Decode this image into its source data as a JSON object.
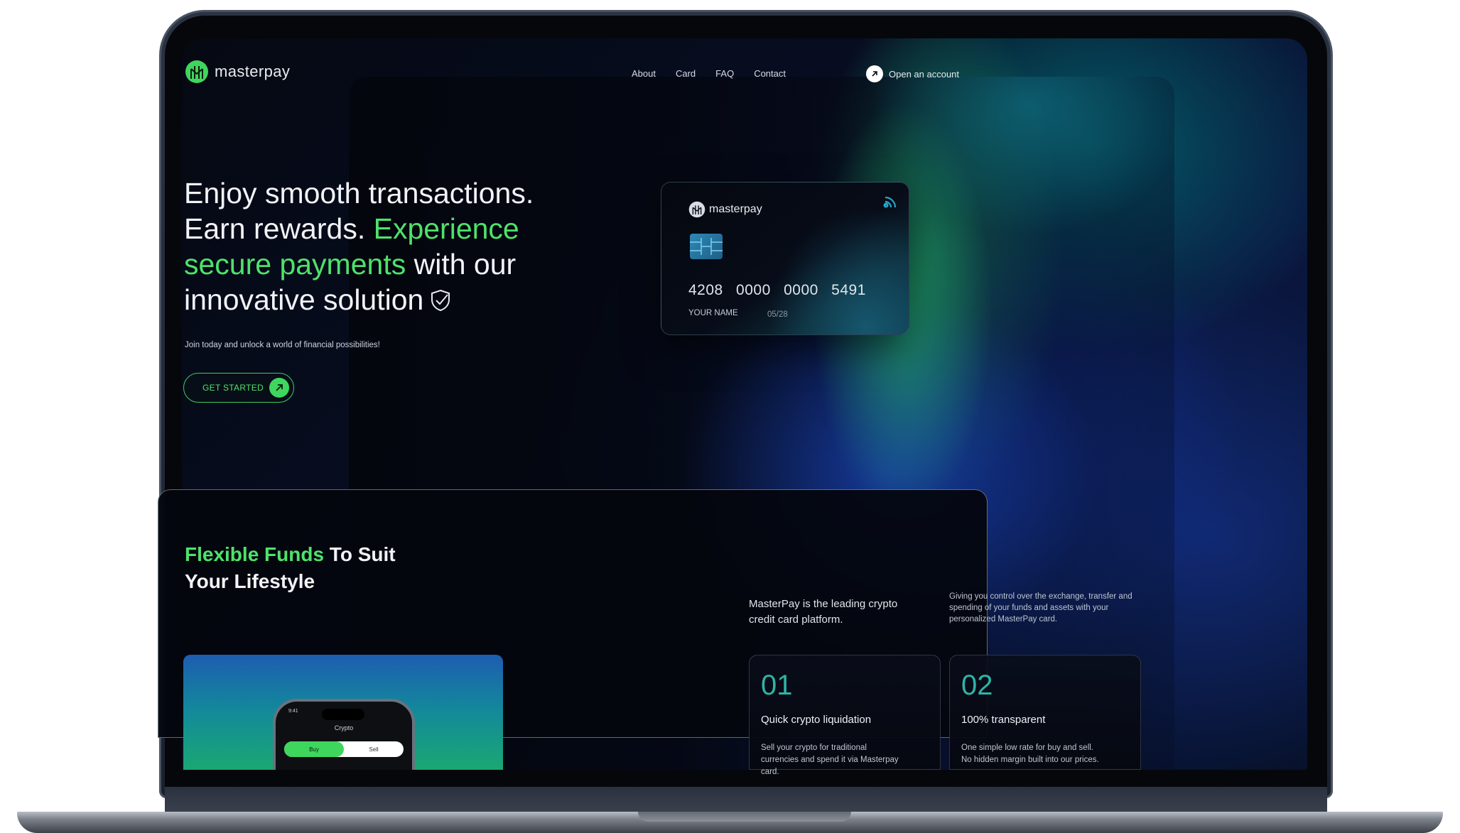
{
  "brand": {
    "name": "masterpay",
    "accent_color": "#4ee26a"
  },
  "nav": {
    "links": [
      "About",
      "Card",
      "FAQ",
      "Contact"
    ],
    "cta_label": "Open an account"
  },
  "hero": {
    "title_part1": "Enjoy smooth transactions. Earn rewards. ",
    "title_accent": "Experience secure payments",
    "title_part2": " with our innovative solution",
    "subtitle": "Join today and unlock a world of financial possibilities!",
    "cta_label": "GET STARTED"
  },
  "card": {
    "brand": "masterpay",
    "number": "4208 0000 0000 5491",
    "holder": "YOUR NAME",
    "expiry": "05/28"
  },
  "features": {
    "title_accent": "Flexible Funds",
    "title_rest": " To Suit Your Lifestyle",
    "lead": "MasterPay is the leading crypto credit card platform.",
    "description": "Giving you control over the exchange, transfer and spending of your funds and assets with your personalized MasterPay card.",
    "phone": {
      "time": "9:41",
      "title": "Crypto",
      "buy_label": "Buy",
      "sell_label": "Sell"
    },
    "items": [
      {
        "number": "01",
        "heading": "Quick crypto liquidation",
        "text": "Sell your crypto for traditional currencies and spend it via Masterpay card."
      },
      {
        "number": "02",
        "heading": "100% transparent",
        "text": "One simple low rate for buy and sell. No hidden margin built into our prices."
      }
    ]
  }
}
